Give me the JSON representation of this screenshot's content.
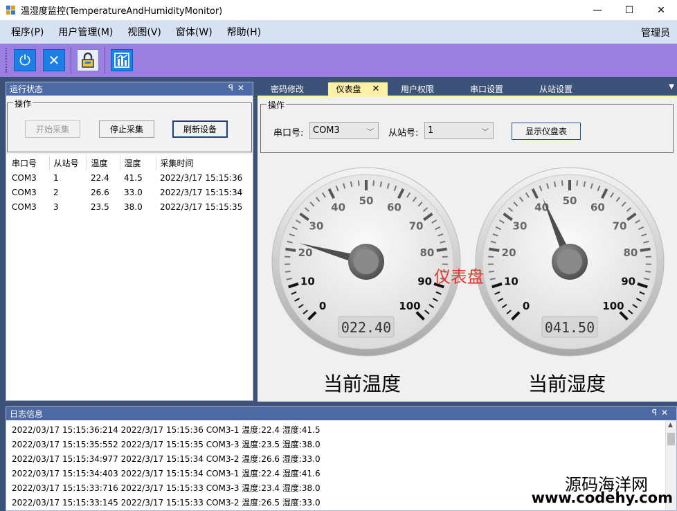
{
  "window": {
    "title": "温湿度监控(TemperatureAndHumidityMonitor)",
    "minimize": "—",
    "maximize": "☐",
    "close": "✕"
  },
  "menu": {
    "items": [
      "程序(P)",
      "用户管理(M)",
      "视图(V)",
      "窗体(W)",
      "帮助(H)"
    ],
    "user": "管理员"
  },
  "toolbar": {
    "icons": [
      "power-icon",
      "close-icon",
      "lock-icon",
      "chart-icon"
    ],
    "power_glyph": "⏻",
    "close_glyph": "✕"
  },
  "status_panel": {
    "title": "运行状态",
    "pin": "ꟼ",
    "close": "✕",
    "group_label": "操作",
    "start_button": "开始采集",
    "stop_button": "停止采集",
    "refresh_button": "刷新设备",
    "columns": [
      "串口号",
      "从站号",
      "温度",
      "湿度",
      "采集时间"
    ],
    "rows": [
      [
        "COM3",
        "1",
        "22.4",
        "41.5",
        "2022/3/17 15:15:36"
      ],
      [
        "COM3",
        "2",
        "26.6",
        "33.0",
        "2022/3/17 15:15:34"
      ],
      [
        "COM3",
        "3",
        "23.5",
        "38.0",
        "2022/3/17 15:15:35"
      ]
    ]
  },
  "tabs": {
    "items": [
      "密码修改",
      "仪表盘",
      "用户权限",
      "串口设置",
      "从站设置"
    ],
    "active": "仪表盘",
    "close": "✕",
    "menu_glyph": "▼"
  },
  "dashboard": {
    "group_label": "操作",
    "port_label": "串口号:",
    "port_value": "COM3",
    "slave_label": "从站号:",
    "slave_value": "1",
    "show_button": "显示仪盘表",
    "overlay": "仪表盘",
    "gauge_ticks": [
      "0",
      "10",
      "20",
      "30",
      "40",
      "50",
      "60",
      "70",
      "80",
      "90",
      "100"
    ],
    "temperature": {
      "value": 22.4,
      "display": "022.40",
      "label": "当前温度"
    },
    "humidity": {
      "value": 41.5,
      "display": "041.50",
      "label": "当前湿度"
    }
  },
  "log": {
    "title": "日志信息",
    "pin": "ꟼ",
    "close": "✕",
    "lines": [
      "2022/03/17 15:15:36:214  2022/3/17 15:15:36 COM3-1 温度:22.4 湿度:41.5",
      "2022/03/17 15:15:35:552  2022/3/17 15:15:35 COM3-3 温度:23.5 湿度:38.0",
      "2022/03/17 15:15:34:977  2022/3/17 15:15:34 COM3-2 温度:26.6 湿度:33.0",
      "2022/03/17 15:15:34:403  2022/3/17 15:15:34 COM3-1 温度:22.4 湿度:41.6",
      "2022/03/17 15:15:33:716  2022/3/17 15:15:33 COM3-3 温度:23.4 湿度:38.0",
      "2022/03/17 15:15:33:145  2022/3/17 15:15:33 COM3-2 温度:26.5 湿度:33.0"
    ]
  },
  "watermark": {
    "line1": "源码海洋网",
    "line2": "www.codehy.com"
  }
}
